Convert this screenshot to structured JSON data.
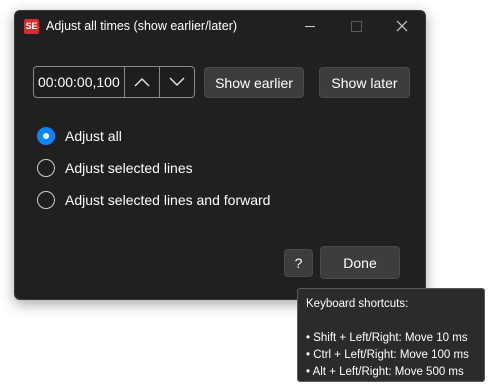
{
  "window": {
    "app_icon_text": "SE",
    "title": "Adjust all times (show earlier/later)"
  },
  "time_adjust": {
    "value": "00:00:00,100",
    "up_icon": "chevron-up-icon",
    "down_icon": "chevron-down-icon"
  },
  "buttons": {
    "show_earlier": "Show earlier",
    "show_later": "Show later",
    "help": "?",
    "done": "Done"
  },
  "radios": [
    {
      "label": "Adjust all",
      "checked": true
    },
    {
      "label": "Adjust selected lines",
      "checked": false
    },
    {
      "label": "Adjust selected lines and forward",
      "checked": false
    }
  ],
  "tooltip": {
    "title": "Keyboard shortcuts:",
    "lines": [
      "• Shift + Left/Right: Move 10 ms",
      "• Ctrl + Left/Right: Move 100 ms",
      "• Alt + Left/Right: Move 500 ms"
    ]
  },
  "colors": {
    "accent": "#0a84ff",
    "window_bg": "#202020",
    "button_bg": "#3d3d3d",
    "app_icon": "#d32f2f"
  }
}
